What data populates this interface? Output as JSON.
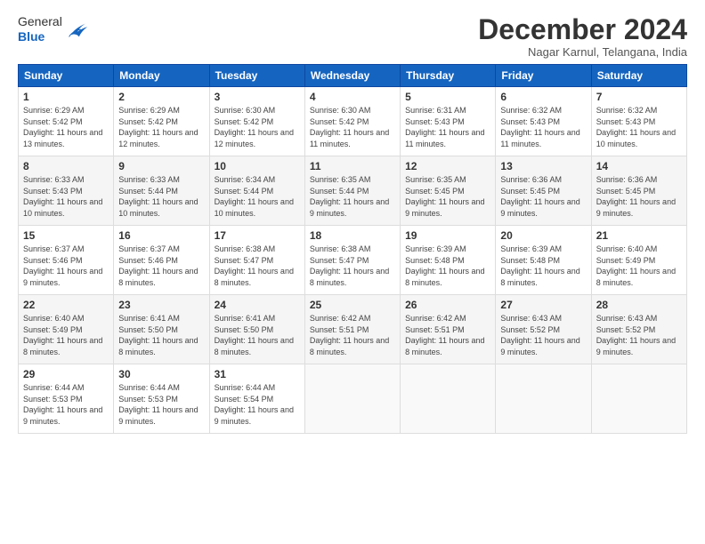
{
  "logo": {
    "general": "General",
    "blue": "Blue"
  },
  "header": {
    "month": "December 2024",
    "location": "Nagar Karnul, Telangana, India"
  },
  "weekdays": [
    "Sunday",
    "Monday",
    "Tuesday",
    "Wednesday",
    "Thursday",
    "Friday",
    "Saturday"
  ],
  "weeks": [
    [
      {
        "day": 1,
        "sunrise": "6:29 AM",
        "sunset": "5:42 PM",
        "daylight": "11 hours and 13 minutes."
      },
      {
        "day": 2,
        "sunrise": "6:29 AM",
        "sunset": "5:42 PM",
        "daylight": "11 hours and 12 minutes."
      },
      {
        "day": 3,
        "sunrise": "6:30 AM",
        "sunset": "5:42 PM",
        "daylight": "11 hours and 12 minutes."
      },
      {
        "day": 4,
        "sunrise": "6:30 AM",
        "sunset": "5:42 PM",
        "daylight": "11 hours and 11 minutes."
      },
      {
        "day": 5,
        "sunrise": "6:31 AM",
        "sunset": "5:43 PM",
        "daylight": "11 hours and 11 minutes."
      },
      {
        "day": 6,
        "sunrise": "6:32 AM",
        "sunset": "5:43 PM",
        "daylight": "11 hours and 11 minutes."
      },
      {
        "day": 7,
        "sunrise": "6:32 AM",
        "sunset": "5:43 PM",
        "daylight": "11 hours and 10 minutes."
      }
    ],
    [
      {
        "day": 8,
        "sunrise": "6:33 AM",
        "sunset": "5:43 PM",
        "daylight": "11 hours and 10 minutes."
      },
      {
        "day": 9,
        "sunrise": "6:33 AM",
        "sunset": "5:44 PM",
        "daylight": "11 hours and 10 minutes."
      },
      {
        "day": 10,
        "sunrise": "6:34 AM",
        "sunset": "5:44 PM",
        "daylight": "11 hours and 10 minutes."
      },
      {
        "day": 11,
        "sunrise": "6:35 AM",
        "sunset": "5:44 PM",
        "daylight": "11 hours and 9 minutes."
      },
      {
        "day": 12,
        "sunrise": "6:35 AM",
        "sunset": "5:45 PM",
        "daylight": "11 hours and 9 minutes."
      },
      {
        "day": 13,
        "sunrise": "6:36 AM",
        "sunset": "5:45 PM",
        "daylight": "11 hours and 9 minutes."
      },
      {
        "day": 14,
        "sunrise": "6:36 AM",
        "sunset": "5:45 PM",
        "daylight": "11 hours and 9 minutes."
      }
    ],
    [
      {
        "day": 15,
        "sunrise": "6:37 AM",
        "sunset": "5:46 PM",
        "daylight": "11 hours and 9 minutes."
      },
      {
        "day": 16,
        "sunrise": "6:37 AM",
        "sunset": "5:46 PM",
        "daylight": "11 hours and 8 minutes."
      },
      {
        "day": 17,
        "sunrise": "6:38 AM",
        "sunset": "5:47 PM",
        "daylight": "11 hours and 8 minutes."
      },
      {
        "day": 18,
        "sunrise": "6:38 AM",
        "sunset": "5:47 PM",
        "daylight": "11 hours and 8 minutes."
      },
      {
        "day": 19,
        "sunrise": "6:39 AM",
        "sunset": "5:48 PM",
        "daylight": "11 hours and 8 minutes."
      },
      {
        "day": 20,
        "sunrise": "6:39 AM",
        "sunset": "5:48 PM",
        "daylight": "11 hours and 8 minutes."
      },
      {
        "day": 21,
        "sunrise": "6:40 AM",
        "sunset": "5:49 PM",
        "daylight": "11 hours and 8 minutes."
      }
    ],
    [
      {
        "day": 22,
        "sunrise": "6:40 AM",
        "sunset": "5:49 PM",
        "daylight": "11 hours and 8 minutes."
      },
      {
        "day": 23,
        "sunrise": "6:41 AM",
        "sunset": "5:50 PM",
        "daylight": "11 hours and 8 minutes."
      },
      {
        "day": 24,
        "sunrise": "6:41 AM",
        "sunset": "5:50 PM",
        "daylight": "11 hours and 8 minutes."
      },
      {
        "day": 25,
        "sunrise": "6:42 AM",
        "sunset": "5:51 PM",
        "daylight": "11 hours and 8 minutes."
      },
      {
        "day": 26,
        "sunrise": "6:42 AM",
        "sunset": "5:51 PM",
        "daylight": "11 hours and 8 minutes."
      },
      {
        "day": 27,
        "sunrise": "6:43 AM",
        "sunset": "5:52 PM",
        "daylight": "11 hours and 9 minutes."
      },
      {
        "day": 28,
        "sunrise": "6:43 AM",
        "sunset": "5:52 PM",
        "daylight": "11 hours and 9 minutes."
      }
    ],
    [
      {
        "day": 29,
        "sunrise": "6:44 AM",
        "sunset": "5:53 PM",
        "daylight": "11 hours and 9 minutes."
      },
      {
        "day": 30,
        "sunrise": "6:44 AM",
        "sunset": "5:53 PM",
        "daylight": "11 hours and 9 minutes."
      },
      {
        "day": 31,
        "sunrise": "6:44 AM",
        "sunset": "5:54 PM",
        "daylight": "11 hours and 9 minutes."
      },
      null,
      null,
      null,
      null
    ]
  ]
}
